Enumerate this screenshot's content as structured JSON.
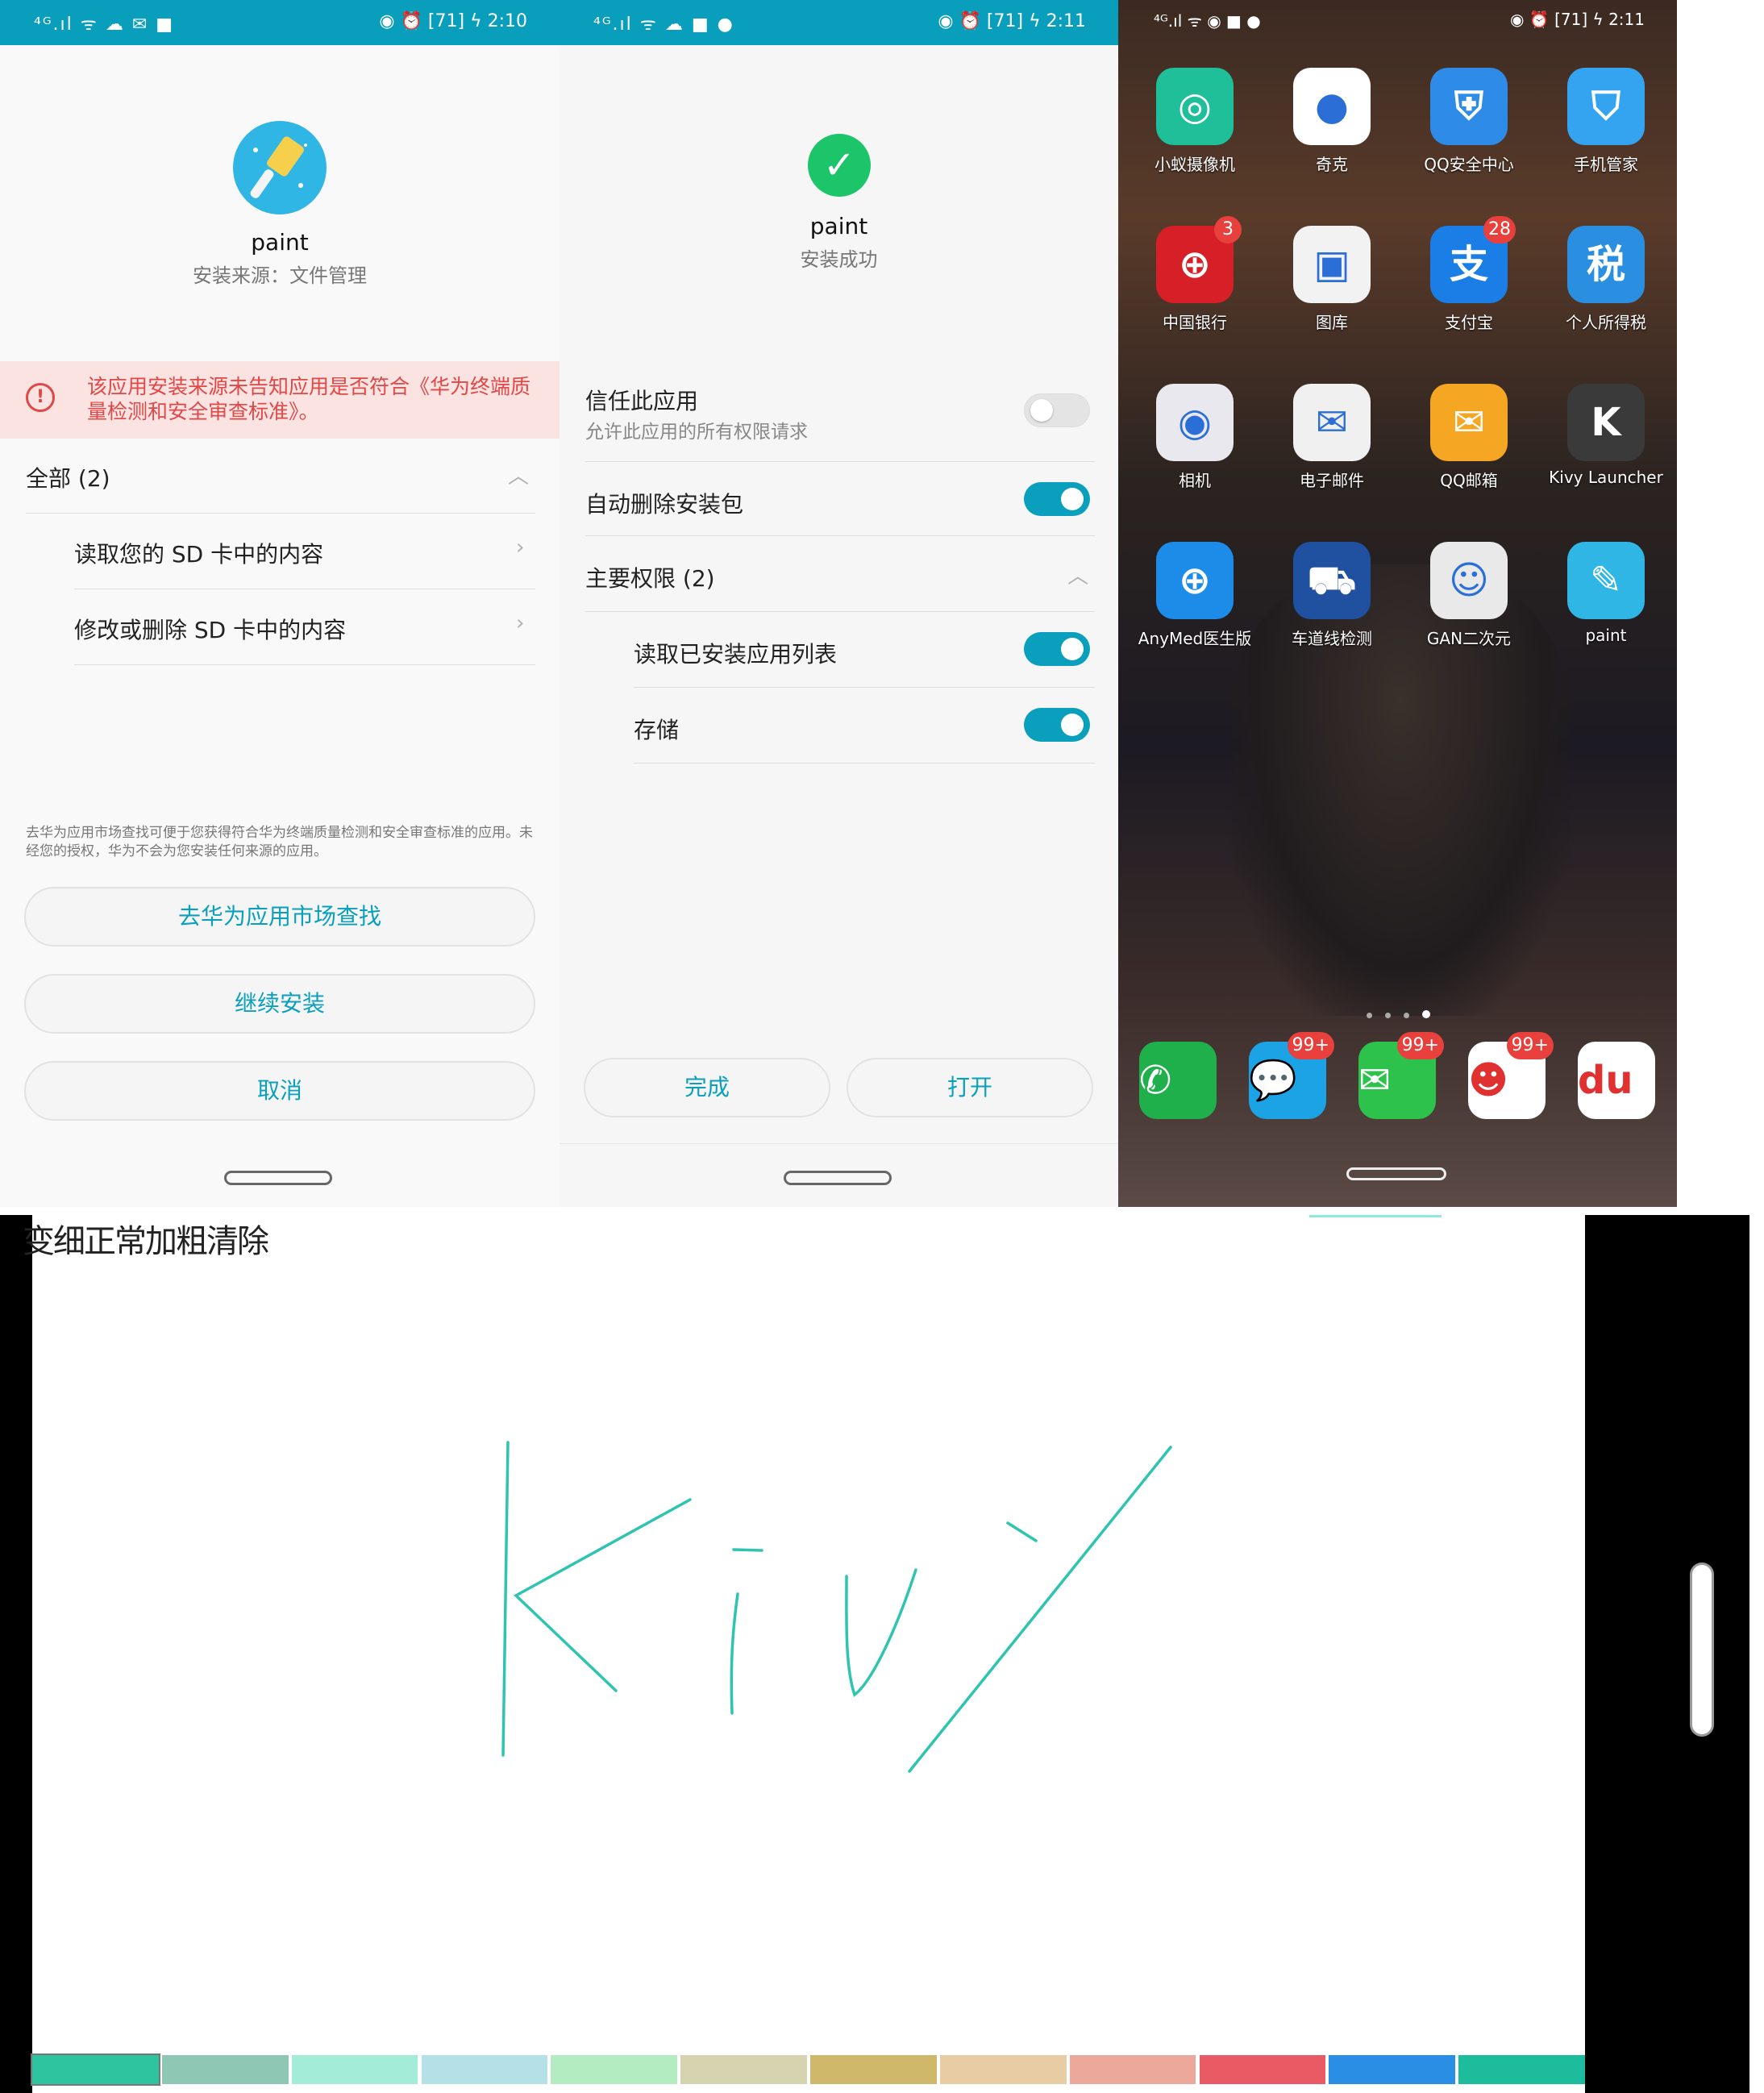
{
  "install": {
    "status_left": "⁴ᴳ.ıl ᯤ ☁ ✉ ■",
    "status_right": "◉ ⏰ [71] ϟ 2:10",
    "app_name": "paint",
    "source": "安装来源：文件管理",
    "warning": "该应用安装来源未告知应用是否符合《华为终端质量检测和安全审查标准》。",
    "all_label": "全部 (2)",
    "perm1": "读取您的 SD 卡中的内容",
    "perm2": "修改或删除 SD 卡中的内容",
    "note": "去华为应用市场查找可便于您获得符合华为终端质量检测和安全审查标准的应用。未经您的授权，华为不会为您安装任何来源的应用。",
    "btn_market": "去华为应用市场查找",
    "btn_continue": "继续安装",
    "btn_cancel": "取消"
  },
  "success": {
    "status_left": "⁴ᴳ.ıl ᯤ ☁ ■ ●",
    "status_right": "◉ ⏰ [71] ϟ 2:11",
    "app_name": "paint",
    "status": "安装成功",
    "trust_title": "信任此应用",
    "trust_sub": "允许此应用的所有权限请求",
    "trust_on": false,
    "autodelete": "自动删除安装包",
    "autodelete_on": true,
    "main_perms": "主要权限 (2)",
    "perm_list": "读取已安装应用列表",
    "perm_list_on": true,
    "perm_storage": "存储",
    "perm_storage_on": true,
    "btn_done": "完成",
    "btn_open": "打开"
  },
  "home": {
    "status_left": "⁴ᴳ.ıl ᯤ ◉ ■ ●",
    "status_right": "◉ ⏰ [71] ϟ 2:11",
    "apps": [
      {
        "label": "小蚁摄像机",
        "icon": "camera-app-icon",
        "color": "#1fbf9a",
        "glyph": "◎",
        "badge": ""
      },
      {
        "label": "奇克",
        "icon": "qike-icon",
        "color": "#ffffff",
        "glyph": "●",
        "badge": ""
      },
      {
        "label": "QQ安全中心",
        "icon": "qq-security-icon",
        "color": "#2e8be8",
        "glyph": "⛨",
        "badge": ""
      },
      {
        "label": "手机管家",
        "icon": "phone-manager-icon",
        "color": "#34a4f0",
        "glyph": "⛉",
        "badge": ""
      },
      {
        "label": "中国银行",
        "icon": "boc-icon",
        "color": "#d61f26",
        "glyph": "⊕",
        "badge": "3"
      },
      {
        "label": "图库",
        "icon": "gallery-icon",
        "color": "#f2f2f2",
        "glyph": "▣",
        "badge": ""
      },
      {
        "label": "支付宝",
        "icon": "alipay-icon",
        "color": "#1a7ee6",
        "glyph": "支",
        "badge": "28"
      },
      {
        "label": "个人所得税",
        "icon": "tax-icon",
        "color": "#2a8fe0",
        "glyph": "税",
        "badge": ""
      },
      {
        "label": "相机",
        "icon": "camera-icon",
        "color": "#e8e8ee",
        "glyph": "◉",
        "badge": ""
      },
      {
        "label": "电子邮件",
        "icon": "email-icon",
        "color": "#f0f0f0",
        "glyph": "✉",
        "badge": ""
      },
      {
        "label": "QQ邮箱",
        "icon": "qqmail-icon",
        "color": "#f5a623",
        "glyph": "✉",
        "badge": ""
      },
      {
        "label": "Kivy Launcher",
        "icon": "kivy-launcher-icon",
        "color": "#3a3a3a",
        "glyph": "K",
        "badge": ""
      },
      {
        "label": "AnyMed医生版",
        "icon": "anymed-icon",
        "color": "#1d8ce8",
        "glyph": "⊕",
        "badge": ""
      },
      {
        "label": "车道线检测",
        "icon": "lane-detect-icon",
        "color": "#2050a0",
        "glyph": "⛟",
        "badge": ""
      },
      {
        "label": "GAN二次元",
        "icon": "gan-icon",
        "color": "#e9e9e9",
        "glyph": "☺",
        "badge": ""
      },
      {
        "label": "paint",
        "icon": "paint-icon",
        "color": "#2fb6e4",
        "glyph": "✎",
        "badge": ""
      }
    ],
    "dock": [
      {
        "icon": "phone-icon",
        "color": "#1fb04c",
        "glyph": "✆",
        "badge": ""
      },
      {
        "icon": "messages-icon",
        "color": "#1ca3e6",
        "glyph": "💬",
        "badge": "99+"
      },
      {
        "icon": "wechat-icon",
        "color": "#2dc24c",
        "glyph": "✉",
        "badge": "99+"
      },
      {
        "icon": "qq-icon",
        "color": "#ffffff",
        "glyph": "☻",
        "badge": "99+"
      },
      {
        "icon": "baidu-map-icon",
        "color": "#ffffff",
        "glyph": "du",
        "badge": ""
      }
    ]
  },
  "paint": {
    "menu": "变细正常加粗清除",
    "drawn_text": "Kivy",
    "stroke_color": "#2ec4b0",
    "palette": [
      "#2ec4a0",
      "#8ec8b4",
      "#a2ecd8",
      "#b4e0e8",
      "#b2ecc0",
      "#d6d4b0",
      "#cfb86a",
      "#e8cca4",
      "#eca89a",
      "#ea5a64",
      "#2a8ee4",
      "#1cbc9c"
    ]
  }
}
